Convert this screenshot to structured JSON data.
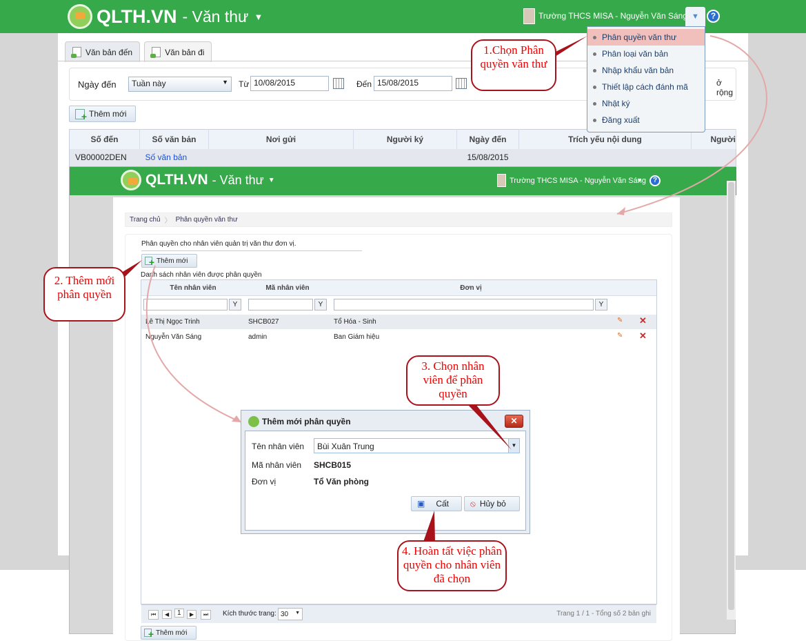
{
  "app": {
    "logo": "QLTH.VN",
    "module": "- Văn thư",
    "user": "Trường THCS MISA - Nguyễn Văn Sáng"
  },
  "tabs": [
    {
      "label": "Văn bản đến"
    },
    {
      "label": "Văn bản đi"
    }
  ],
  "filter": {
    "label": "Ngày đến",
    "period": "Tuần này",
    "from_label": "Từ",
    "from": "10/08/2015",
    "to_label": "Đến",
    "to": "15/08/2015",
    "extra": "ở rộng"
  },
  "add_label": "Thêm mới",
  "doc_table": {
    "headers": [
      "Số đến",
      "Số văn bản",
      "Nơi gửi",
      "Người ký",
      "Ngày đến",
      "Trích yếu nội dung",
      "Người"
    ],
    "row": [
      "VB00002DEN",
      "Số văn bản",
      "",
      "",
      "15/08/2015",
      "",
      ""
    ]
  },
  "menu": [
    "Phân quyền văn thư",
    "Phân loại văn bản",
    "Nhập khẩu văn bản",
    "Thiết lập cách đánh mã",
    "Nhật ký",
    "Đăng xuất"
  ],
  "inner": {
    "breadcrumb": [
      "Trang chủ",
      "Phân quyền văn thư"
    ],
    "desc": "Phân quyền cho nhân viên quản trị văn thư đơn vị.",
    "list_title": "Danh sách nhân viên được phân quyền",
    "headers": [
      "Tên nhân viên",
      "Mã nhân viên",
      "Đơn vị"
    ],
    "rows": [
      [
        "Lê Thị Ngọc Trinh",
        "SHCB027",
        "Tổ Hóa - Sinh"
      ],
      [
        "Nguyễn Văn Sáng",
        "admin",
        "Ban Giám hiệu"
      ]
    ],
    "pager": {
      "page": "1",
      "size_label": "Kích thước trang:",
      "size": "30",
      "summary": "Trang 1 / 1 - Tổng số 2 bản ghi"
    }
  },
  "dialog": {
    "title": "Thêm mới phân quyền",
    "name_label": "Tên nhân viên",
    "name": "Bùi Xuân  Trung",
    "code_label": "Mã nhân viên",
    "code": "SHCB015",
    "unit_label": "Đơn vị",
    "unit": "Tổ Văn phòng",
    "save": "Cất",
    "cancel": "Hủy bỏ"
  },
  "callouts": [
    "1.Chọn Phân quyền văn thư",
    "2. Thêm mới phân quyền",
    "3. Chọn nhân viên để phân quyền",
    "4. Hoàn tất việc phân quyền cho nhân viên đã chọn"
  ],
  "colors": {
    "green": "#36a94a",
    "callout": "#e00000"
  }
}
